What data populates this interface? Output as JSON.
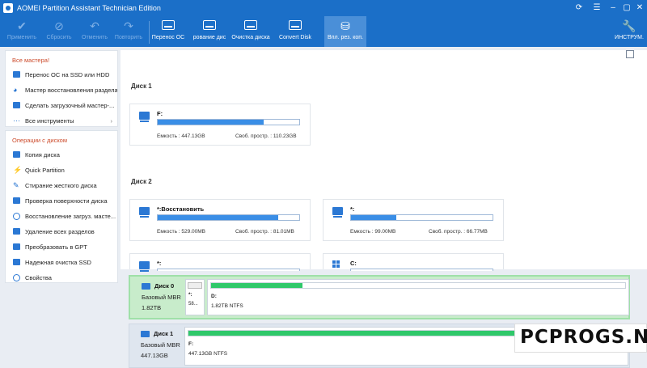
{
  "app": {
    "title": "AOMEI Partition Assistant Technician Edition"
  },
  "toolbar": {
    "items": [
      {
        "label": "Применить",
        "icon": "check-icon",
        "enabled": false
      },
      {
        "label": "Сбросить",
        "icon": "cancel-icon",
        "enabled": false
      },
      {
        "label": "Отменить",
        "icon": "undo-icon",
        "enabled": false
      },
      {
        "label": "Повторить",
        "icon": "redo-icon",
        "enabled": false
      },
      {
        "label": "Перенос ОС",
        "icon": "migrate-os-icon",
        "enabled": true
      },
      {
        "label": "рование дис",
        "icon": "disk-copy-icon",
        "enabled": true
      },
      {
        "label": "Очистка диска",
        "icon": "disk-cleanup-icon",
        "enabled": true
      },
      {
        "label": "Convert Disk",
        "icon": "convert-disk-icon",
        "enabled": true
      },
      {
        "label": "Впл. рез. коп.",
        "icon": "backup-icon",
        "enabled": true
      }
    ],
    "tools_label": "ИНСТРУМ."
  },
  "sidebar": {
    "wizards": {
      "title": "Все мастера!",
      "items": [
        {
          "label": "Перенос ОС на SSD или HDD",
          "icon": "migrate-icon"
        },
        {
          "label": "Мастер восстановления раздела",
          "icon": "recovery-icon"
        },
        {
          "label": "Сделать загрузочный мастер-...",
          "icon": "bootable-icon"
        },
        {
          "label": "Все инструменты",
          "icon": "more-icon"
        }
      ]
    },
    "operations": {
      "title": "Операции с диском",
      "items": [
        {
          "label": "Копия диска",
          "icon": "copy-disk-icon"
        },
        {
          "label": "Quick Partition",
          "icon": "quick-partition-icon"
        },
        {
          "label": "Стирание жесткого диска",
          "icon": "wipe-icon"
        },
        {
          "label": "Проверка поверхности диска",
          "icon": "surface-test-icon"
        },
        {
          "label": "Восстановление загруз. масте...",
          "icon": "rebuild-mbr-icon"
        },
        {
          "label": "Удаление всех разделов",
          "icon": "delete-partitions-icon"
        },
        {
          "label": "Преобразовать в GPT",
          "icon": "convert-gpt-icon"
        },
        {
          "label": "Надежная очистка SSD",
          "icon": "ssd-erase-icon"
        },
        {
          "label": "Свойства",
          "icon": "info-icon"
        }
      ]
    }
  },
  "main": {
    "disk1": {
      "label": "Диск 1",
      "partitions": [
        {
          "name": "F:",
          "capacity": "Емкость : 447.13GB",
          "free": "Своб. простр. : 110.23GB",
          "used_fraction": 0.75
        }
      ]
    },
    "disk2": {
      "label": "Диск 2",
      "partitions": [
        {
          "name": "*:Восстановить",
          "capacity": "Емкость : 529.00MB",
          "free": "Своб. простр. : 81.01MB",
          "used_fraction": 0.85
        },
        {
          "name": "*:",
          "capacity": "Емкость : 99.00MB",
          "free": "Своб. простр. : 66.77MB",
          "used_fraction": 0.32
        },
        {
          "name": "*:",
          "capacity": "",
          "free": "",
          "used_fraction": 0
        },
        {
          "name": "C:",
          "capacity": "",
          "free": "",
          "used_fraction": 0
        }
      ]
    }
  },
  "diskmap": {
    "rows": [
      {
        "name": "Диск 0",
        "type": "Базовый MBR",
        "size": "1.82TB",
        "small": {
          "name": "*:",
          "size": "58..."
        },
        "part": {
          "name": "D:",
          "info": "1.82TB NTFS",
          "used_fraction": 0.22
        }
      },
      {
        "name": "Диск 1",
        "type": "Базовый MBR",
        "size": "447.13GB",
        "part": {
          "name": "F:",
          "info": "447.13GB NTFS",
          "used_fraction": 0.75
        }
      }
    ]
  },
  "watermark": "PCPROGS.NET"
}
